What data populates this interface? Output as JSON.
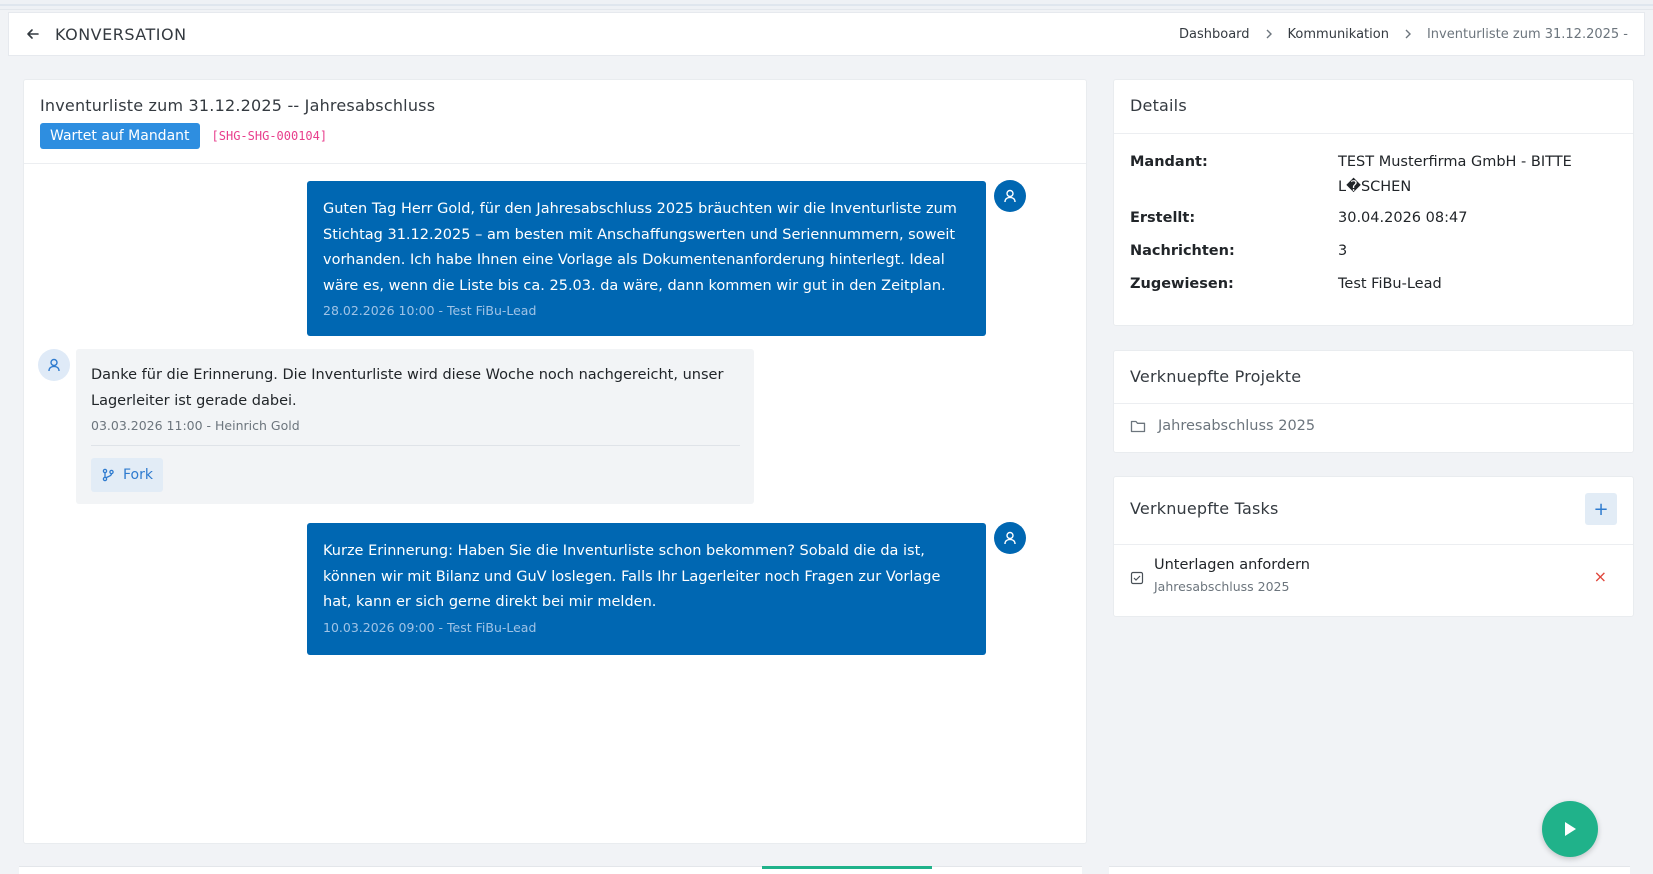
{
  "header": {
    "title": "KONVERSATION",
    "breadcrumb": [
      "Dashboard",
      "Kommunikation",
      "Inventurliste zum 31.12.2025 -"
    ]
  },
  "conversation": {
    "title": "Inventurliste zum 31.12.2025 -- Jahresabschluss",
    "status": "Wartet auf Mandant",
    "status_color": "#2e8ee0",
    "code": "[SHG-SHG-000104]",
    "messages": [
      {
        "direction": "out",
        "text": "Guten Tag Herr Gold, für den Jahresabschluss 2025 bräuchten wir die Inventurliste zum Stichtag 31.12.2025 – am besten mit Anschaffungswerten und Seriennummern, soweit vorhanden. Ich habe Ihnen eine Vorlage als Dokumentenanforderung hinterlegt. Ideal wäre es, wenn die Liste bis ca. 25.03. da wäre, dann kommen wir gut in den Zeitplan.",
        "meta": "28.02.2026 10:00 - Test FiBu-Lead"
      },
      {
        "direction": "in",
        "text": "Danke für die Erinnerung. Die Inventurliste wird diese Woche noch nachgereicht, unser Lagerleiter ist gerade dabei.",
        "meta": "03.03.2026 11:00 - Heinrich Gold",
        "action": "Fork"
      },
      {
        "direction": "out",
        "text": "Kurze Erinnerung: Haben Sie die Inventurliste schon bekommen? Sobald die da ist, können wir mit Bilanz und GuV loslegen. Falls Ihr Lagerleiter noch Fragen zur Vorlage hat, kann er sich gerne direkt bei mir melden.",
        "meta": "10.03.2026 09:00 - Test FiBu-Lead"
      }
    ]
  },
  "details": {
    "title": "Details",
    "rows": [
      {
        "key": "Mandant:",
        "value": "TEST Musterfirma GmbH - BITTE L�SCHEN"
      },
      {
        "key": "Erstellt:",
        "value": "30.04.2026 08:47"
      },
      {
        "key": "Nachrichten:",
        "value": "3"
      },
      {
        "key": "Zugewiesen:",
        "value": "Test FiBu-Lead"
      }
    ]
  },
  "projects": {
    "title": "Verknuepfte Projekte",
    "items": [
      "Jahresabschluss 2025"
    ]
  },
  "tasks": {
    "title": "Verknuepfte Tasks",
    "add_label": "+",
    "items": [
      {
        "title": "Unterlagen anfordern",
        "project": "Jahresabschluss 2025",
        "remove_label": "×"
      }
    ]
  },
  "colors": {
    "primary": "#0067b2",
    "accent_green": "#20b28a",
    "danger": "#e0463b"
  }
}
